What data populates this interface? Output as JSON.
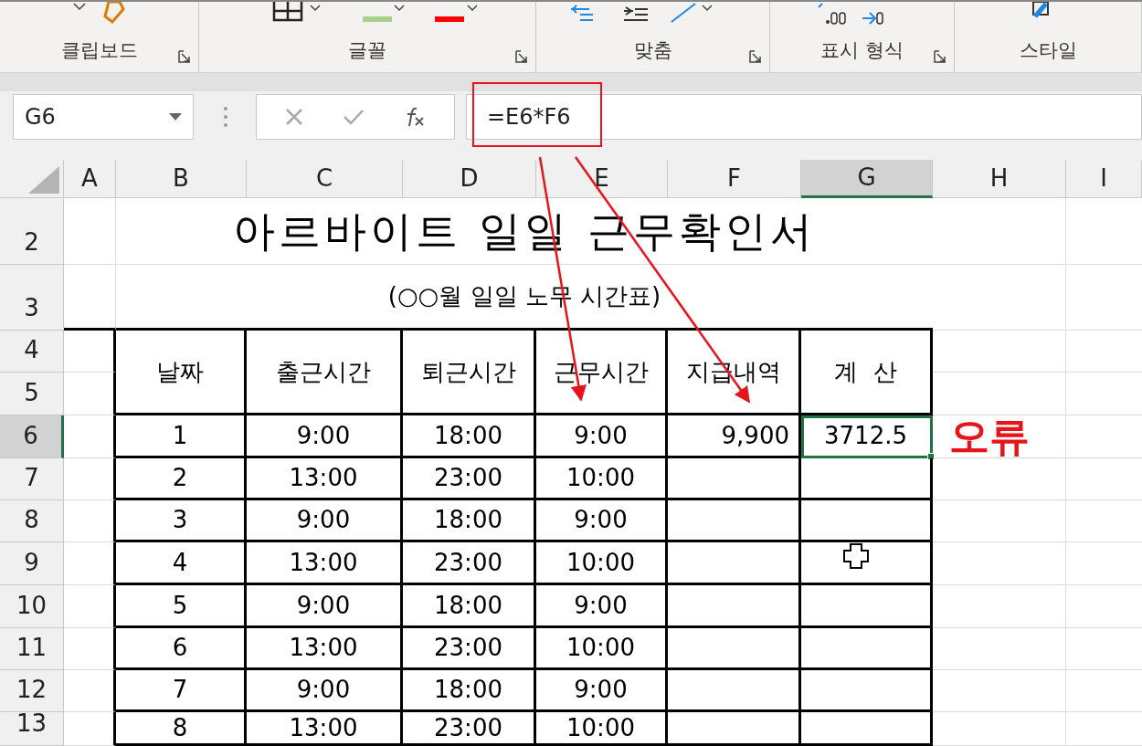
{
  "ribbon": {
    "groups": [
      {
        "label": "클립보드"
      },
      {
        "label": "글꼴"
      },
      {
        "label": "맞춤"
      },
      {
        "label": "표시 형식"
      },
      {
        "label": "스타일"
      }
    ]
  },
  "formula_bar": {
    "name_box": "G6",
    "formula": "=E6*F6",
    "highlighted": true
  },
  "columns": [
    {
      "label": "A",
      "selected": false
    },
    {
      "label": "B",
      "selected": false
    },
    {
      "label": "C",
      "selected": false
    },
    {
      "label": "D",
      "selected": false
    },
    {
      "label": "E",
      "selected": false
    },
    {
      "label": "F",
      "selected": false
    },
    {
      "label": "G",
      "selected": true
    },
    {
      "label": "H",
      "selected": false
    },
    {
      "label": "I",
      "selected": false
    }
  ],
  "row_headers": [
    {
      "label": "2",
      "selected": false
    },
    {
      "label": "3",
      "selected": false
    },
    {
      "label": "4",
      "selected": false
    },
    {
      "label": "5",
      "selected": false
    },
    {
      "label": "6",
      "selected": true
    },
    {
      "label": "7",
      "selected": false
    },
    {
      "label": "8",
      "selected": false
    },
    {
      "label": "9",
      "selected": false
    },
    {
      "label": "10",
      "selected": false
    },
    {
      "label": "11",
      "selected": false
    },
    {
      "label": "12",
      "selected": false
    },
    {
      "label": "13",
      "selected": false
    }
  ],
  "sheet": {
    "title": "아르바이트 일일 근무확인서",
    "subtitle": "(○○월 일일 노무 시간표)",
    "headers": [
      "날짜",
      "출근시간",
      "퇴근시간",
      "근무시간",
      "지급내역",
      "계  산"
    ],
    "rows": [
      {
        "cells": [
          "1",
          "9:00",
          "18:00",
          "9:00",
          "9,900",
          "3712.5"
        ],
        "calc_selected": true
      },
      {
        "cells": [
          "2",
          "13:00",
          "23:00",
          "10:00"
        ],
        "calc_selected": false
      },
      {
        "cells": [
          "3",
          "9:00",
          "18:00",
          "9:00"
        ],
        "calc_selected": false
      },
      {
        "cells": [
          "4",
          "13:00",
          "23:00",
          "10:00"
        ],
        "calc_selected": false
      },
      {
        "cells": [
          "5",
          "9:00",
          "18:00",
          "9:00"
        ],
        "calc_selected": false
      },
      {
        "cells": [
          "6",
          "13:00",
          "23:00",
          "10:00"
        ],
        "calc_selected": false
      },
      {
        "cells": [
          "7",
          "9:00",
          "18:00",
          "9:00"
        ],
        "calc_selected": false
      },
      {
        "cells": [
          "8",
          "13:00",
          "23:00",
          "10:00"
        ],
        "calc_selected": false
      }
    ]
  },
  "annotation": {
    "label": "오류"
  }
}
